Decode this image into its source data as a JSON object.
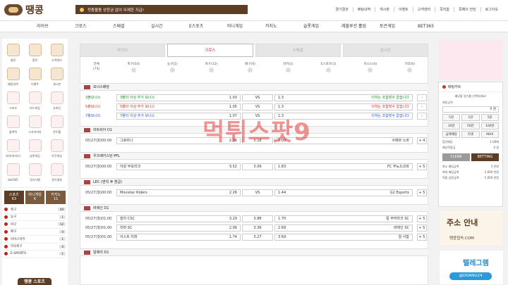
{
  "header": {
    "logo": "땡콩",
    "notice": "첫충불충 상한금 없이 무제한 지급!",
    "links": [
      "경기결과",
      "배팅내역",
      "게시판",
      "이벤트",
      "고객센터",
      "쪽지함",
      "쪽해의 전당",
      "로그아웃"
    ]
  },
  "nav": [
    "라이브",
    "크로스",
    "스페셜",
    "실시간",
    "E스포츠",
    "미니게임",
    "카지노",
    "슬롯게임",
    "레볼루션 홀덤",
    "토큰게임",
    "BET365"
  ],
  "left": {
    "icons": [
      "충전",
      "환전",
      "고객센터",
      "배팅내역",
      "이벤트",
      "게시판",
      "스포츠",
      "보드게임",
      "슈퍼인",
      "블랙잭",
      "스카이마카",
      "컨트롤",
      "러쉬(마카오)",
      "슬롯게임",
      "토큰게임",
      "bet365",
      "경기사행",
      "경기결과"
    ],
    "tabs": [
      {
        "l": "스포츠",
        "c": "63"
      },
      {
        "l": "미니게임",
        "c": "6"
      },
      {
        "l": "카지노",
        "c": "11"
      }
    ],
    "sports": [
      {
        "n": "축구",
        "c": "49"
      },
      {
        "n": "농구",
        "c": "1"
      },
      {
        "n": "야구",
        "c": "12"
      },
      {
        "n": "배구",
        "c": "0"
      },
      {
        "n": "아이스하키",
        "c": "1"
      },
      {
        "n": "미식축구",
        "c": "0"
      },
      {
        "n": "E-SPORTS",
        "c": "1"
      }
    ],
    "banner": "땡콩 스포츠"
  },
  "tabs": [
    "라이브",
    "크로스",
    "스페셜",
    "실시간"
  ],
  "filters": [
    {
      "n": "전체",
      "c": "(73)"
    },
    {
      "n": "축구(54)"
    },
    {
      "n": "농구(1)"
    },
    {
      "n": "야구(12)"
    },
    {
      "n": "배구(0)"
    },
    {
      "n": "하키(1)"
    },
    {
      "n": "E스포츠(1)"
    },
    {
      "n": "미니스(4)"
    },
    {
      "n": "기타(0)"
    }
  ],
  "bonus": {
    "title": "보너스배당",
    "rows": [
      {
        "dt": "3폴보너스",
        "h": "3폴더 이상 추가 보너스",
        "ho": "1.03",
        "a": "1.3",
        "an": "이하는 조합횟수 없습니다",
        "col": "#1e8a2c"
      },
      {
        "dt": "5폴보너스",
        "h": "5폴더 이상 추가 보너스",
        "ho": "1.05",
        "a": "1.3",
        "an": "이하는 조합횟수 없습니다",
        "col": "#d42a2a"
      },
      {
        "dt": "7폴보너스",
        "h": "7폴더 이상 추가 보너스",
        "ho": "1.07",
        "a": "1.3",
        "an": "이하는 조합횟수 없습니다",
        "col": "#2a58d4"
      }
    ]
  },
  "leagues": [
    {
      "name": "라트비아 D1",
      "rows": [
        {
          "dt": "05/27(월)00:00",
          "h": "그로비나",
          "ho": "2.36",
          "d": "3.18",
          "ao": "2.09",
          "a": "수페르 노바",
          "m": "+ 4"
        }
      ]
    },
    {
      "name": "우즈베키스탄 PFL",
      "rows": [
        {
          "dt": "05/27(월)00:00",
          "h": "아살 무보리크",
          "ho": "3.52",
          "d": "3.09",
          "ao": "1.83",
          "a": "FC 부뇨드코르",
          "m": "+ 5"
        }
      ]
    },
    {
      "name": "LEC (변칙 후 환급)",
      "rows": [
        {
          "dt": "05/27(월)00:00",
          "h": "Movistar Riders",
          "ho": "2.26",
          "d": "VS",
          "ao": "1.44",
          "a": "G2 Esports",
          "m": "+ 5"
        }
      ]
    },
    {
      "name": "바레인 D1",
      "rows": [
        {
          "dt": "05/27(월)01:00",
          "h": "말리 CSC",
          "ho": "3.29",
          "d": "3.88",
          "ao": "1.70",
          "a": "알 무하라크 SC",
          "m": "+ 5"
        },
        {
          "dt": "05/27(월)01:00",
          "h": "리파 SC",
          "ho": "2.06",
          "d": "3.36",
          "ao": "2.69",
          "a": "바레인 SC",
          "m": "+ 5"
        },
        {
          "dt": "05/27(월)01:00",
          "h": "이스트 리파",
          "ho": "1.74",
          "d": "3.27",
          "ao": "3.69",
          "a": "알 사함",
          "m": "+ 5"
        }
      ]
    },
    {
      "name": "알제리 D1",
      "rows": []
    }
  ],
  "slip": {
    "title": "배팅카트",
    "msg": "배당할 경기를 선택하세요!",
    "amount_label": "배팅금액",
    "amount": "0",
    "unit": "원",
    "btns": [
      "5천",
      "1만",
      "5만",
      "10만",
      "50만",
      "100만",
      "금액배당",
      "리셋",
      "MAX"
    ],
    "kv": [
      {
        "k": "합산배당",
        "v": "1.00배"
      },
      {
        "k": "예상적중금",
        "v": "0 원"
      }
    ],
    "clear": "CLEAR",
    "bet": "BETTING",
    "limits": [
      {
        "k": "최소 배팅금액",
        "v": "5 만원"
      },
      {
        "k": "최대 배팅금액",
        "v": "2,000 만원"
      },
      {
        "k": "적중 상한금액",
        "v": "5,000 만원"
      }
    ]
  },
  "ads": {
    "a1t": "주소 안내",
    "a1s": "땡콩접속.COM",
    "a2t": "텔레그램",
    "a2s": "@DDANG24"
  },
  "watermark": "먹튀스팟9"
}
